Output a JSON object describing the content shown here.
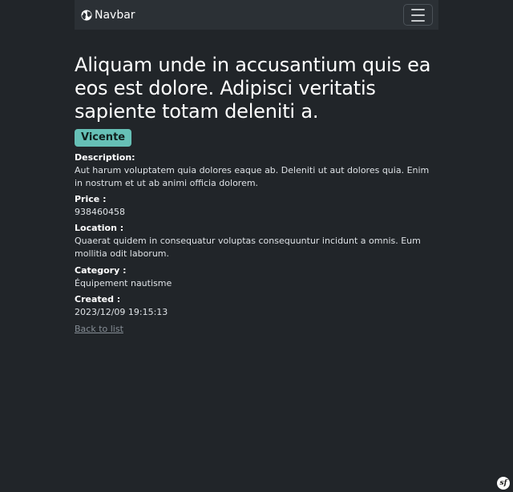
{
  "navbar": {
    "brand_label": "Navbar",
    "brand_icon": "globe-icon",
    "toggler_icon": "hamburger-menu-icon"
  },
  "item": {
    "title": "Aliquam unde in accusantium quis ea eos est dolore. Adipisci veritatis sapiente totam deleniti a.",
    "badge": "Vicente",
    "fields": [
      {
        "label": "Description:",
        "value": "Aut harum voluptatem quia dolores eaque ab. Deleniti ut aut dolores quia. Enim in nostrum et ut ab animi officia dolorem."
      },
      {
        "label": "Price :",
        "value": "938460458"
      },
      {
        "label": "Location :",
        "value": "Quaerat quidem in consequatur voluptas consequuntur incidunt a omnis. Eum mollitia odit laborum."
      },
      {
        "label": "Category :",
        "value": "Équipement nautisme"
      },
      {
        "label": "Created :",
        "value": "2023/12/09 19:15:13"
      }
    ],
    "back_link": "Back to list"
  },
  "debug_toolbar": {
    "icon": "symfony-logo-icon",
    "text": "sf"
  },
  "colors": {
    "page_bg": "#212529",
    "navbar_bg": "#2b3035",
    "badge_bg": "#66c0b6",
    "link": "#868e96"
  }
}
